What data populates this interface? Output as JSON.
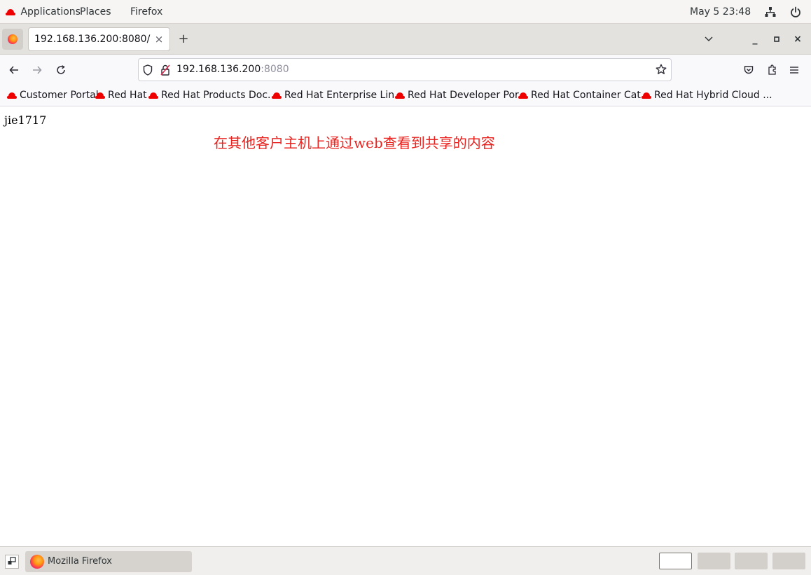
{
  "system_bar": {
    "applications": "Applications",
    "places": "Places",
    "active_app": "Firefox",
    "clock": "May 5  23:48"
  },
  "browser": {
    "tab_title": "192.168.136.200:8080/",
    "tab_close": "×",
    "new_tab": "+",
    "url_host": "192.168.136.200",
    "url_port": ":8080",
    "window_controls": {
      "minimize": "_",
      "maximize": "▫",
      "close": "×"
    }
  },
  "bookmarks": [
    {
      "label": "Customer Portal"
    },
    {
      "label": "Red Hat"
    },
    {
      "label": "Red Hat Products Doc..."
    },
    {
      "label": "Red Hat Enterprise Lin..."
    },
    {
      "label": "Red Hat Developer Por..."
    },
    {
      "label": "Red Hat Container Cat..."
    },
    {
      "label": "Red Hat Hybrid Cloud ..."
    }
  ],
  "page": {
    "body_text": "jie1717",
    "annotation": "在其他客户主机上通过web查看到共享的内容"
  },
  "taskbar": {
    "window_label": "Mozilla Firefox"
  },
  "colors": {
    "redhat_red": "#ee0000",
    "annotation_red": "#e8231f"
  }
}
